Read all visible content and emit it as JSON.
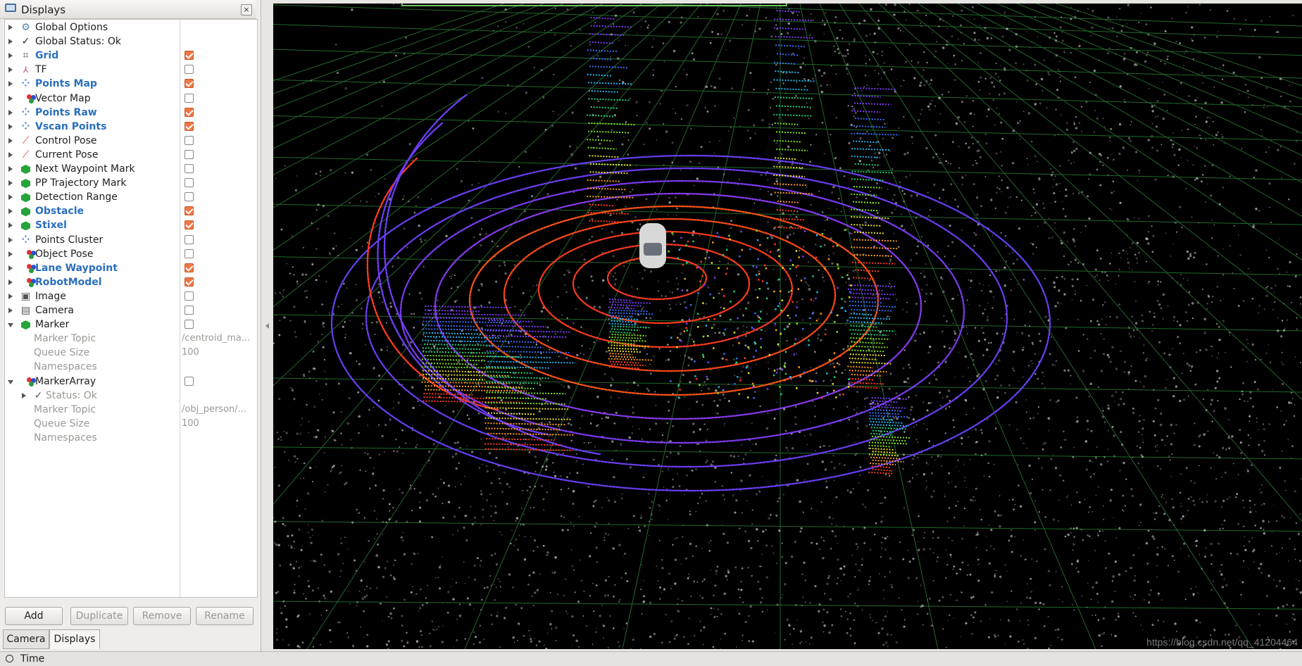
{
  "panel": {
    "title": "Displays",
    "close_icon": "close-icon"
  },
  "tree_items": [
    {
      "label": "Global Options",
      "icon": "gear-icon",
      "bold": false,
      "checkbox": null
    },
    {
      "label": "Global Status: Ok",
      "icon": "check-icon",
      "bold": false,
      "checkbox": null
    },
    {
      "label": "Grid",
      "icon": "grid-icon",
      "bold": true,
      "checkbox": true
    },
    {
      "label": "TF",
      "icon": "tf-icon",
      "bold": false,
      "checkbox": false
    },
    {
      "label": "Points Map",
      "icon": "point-cloud-icon",
      "bold": true,
      "checkbox": true
    },
    {
      "label": "Vector Map",
      "icon": "marker-array-icon",
      "bold": false,
      "checkbox": false
    },
    {
      "label": "Points Raw",
      "icon": "point-cloud-icon",
      "bold": true,
      "checkbox": true
    },
    {
      "label": "Vscan Points",
      "icon": "point-cloud-icon",
      "bold": true,
      "checkbox": true
    },
    {
      "label": "Control Pose",
      "icon": "pose-arrow-icon",
      "bold": false,
      "checkbox": false
    },
    {
      "label": "Current Pose",
      "icon": "pose-arrow-icon",
      "bold": false,
      "checkbox": false
    },
    {
      "label": "Next Waypoint Mark",
      "icon": "marker-icon",
      "bold": false,
      "checkbox": false
    },
    {
      "label": "PP Trajectory Mark",
      "icon": "marker-icon",
      "bold": false,
      "checkbox": false
    },
    {
      "label": "Detection Range",
      "icon": "marker-icon",
      "bold": false,
      "checkbox": false
    },
    {
      "label": "Obstacle",
      "icon": "marker-icon",
      "bold": true,
      "checkbox": true
    },
    {
      "label": "Stixel",
      "icon": "marker-icon",
      "bold": true,
      "checkbox": true
    },
    {
      "label": "Points Cluster",
      "icon": "point-cloud-icon",
      "bold": false,
      "checkbox": false
    },
    {
      "label": "Object Pose",
      "icon": "marker-array-icon",
      "bold": false,
      "checkbox": false
    },
    {
      "label": "Lane Waypoint",
      "icon": "marker-array-icon",
      "bold": true,
      "checkbox": true
    },
    {
      "label": "RobotModel",
      "icon": "marker-array-icon",
      "bold": true,
      "checkbox": true
    },
    {
      "label": "Image",
      "icon": "image-icon",
      "bold": false,
      "checkbox": false
    },
    {
      "label": "Camera",
      "icon": "camera-icon",
      "bold": false,
      "checkbox": false
    },
    {
      "label": "Marker",
      "icon": "marker-icon",
      "bold": false,
      "checkbox": false,
      "expanded": true
    },
    {
      "label": "Marker Topic",
      "sub": true,
      "value": "/centroid_ma..."
    },
    {
      "label": "Queue Size",
      "sub": true,
      "value": "100"
    },
    {
      "label": "Namespaces",
      "sub": true,
      "value": ""
    },
    {
      "label": "MarkerArray",
      "icon": "marker-array-icon",
      "bold": false,
      "checkbox": false,
      "expanded": true
    },
    {
      "label": "Status: Ok",
      "sub": true,
      "status": true,
      "value": ""
    },
    {
      "label": "Marker Topic",
      "sub": true,
      "value": "/obj_person/..."
    },
    {
      "label": "Queue Size",
      "sub": true,
      "value": "100"
    },
    {
      "label": "Namespaces",
      "sub": true,
      "value": ""
    }
  ],
  "buttons": {
    "add": "Add",
    "duplicate": "Duplicate",
    "remove": "Remove",
    "rename": "Rename"
  },
  "tabs": {
    "camera": "Camera",
    "displays": "Displays"
  },
  "bottom": {
    "time_label": "Time"
  },
  "viewport": {
    "watermark": "https://blog.csdn.net/qq_41204464"
  },
  "colors": {
    "bold_label": "#2a6fbd",
    "checkbox_checked": "#f07746",
    "grid_line": "#2e8a3a",
    "background": "#000000"
  }
}
